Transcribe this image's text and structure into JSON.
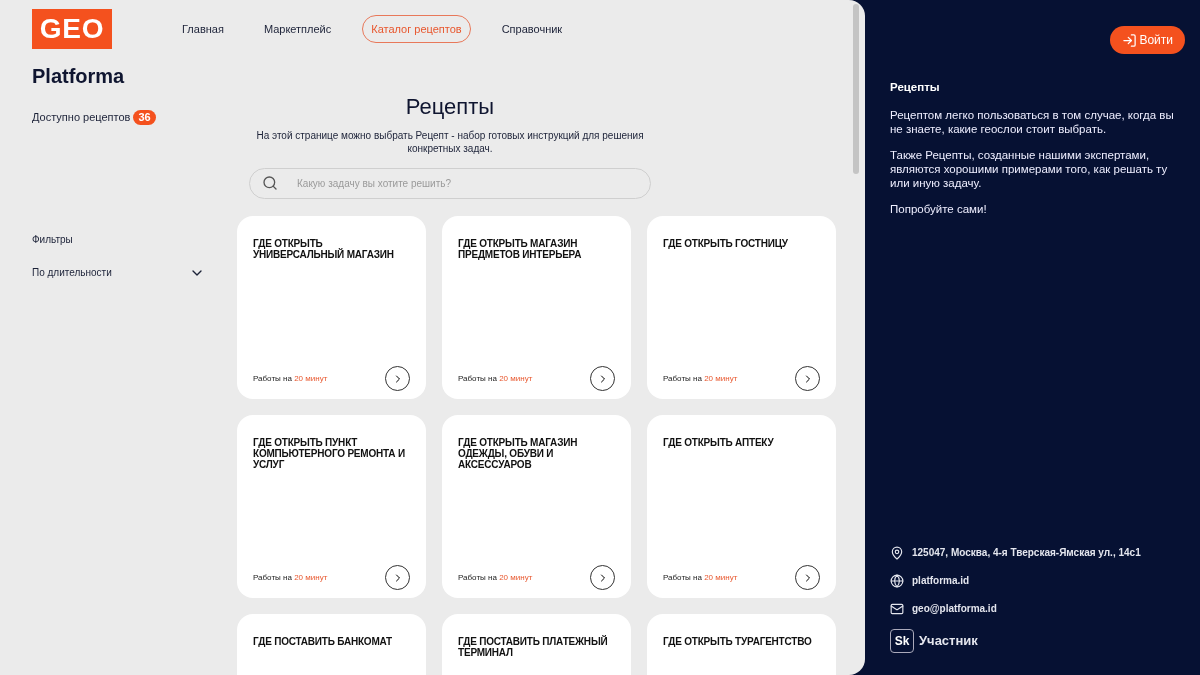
{
  "logo": "GEO",
  "nav": [
    {
      "label": "Главная",
      "selected": false
    },
    {
      "label": "Маркетплейс",
      "selected": false
    },
    {
      "label": "Каталог рецептов",
      "selected": true
    },
    {
      "label": "Справочник",
      "selected": false
    }
  ],
  "sidebar": {
    "brand": "Platforma",
    "available_label": "Доступно рецептов",
    "available_count": "36",
    "filters_title": "Фильтры",
    "filters": [
      {
        "label": "По длительности",
        "expanded": false
      }
    ]
  },
  "main": {
    "title": "Рецепты",
    "subtitle": "На этой странице можно выбрать Рецепт - набор готовых инструкций для решения конкретных задач.",
    "search": {
      "placeholder": "Какую задачу вы хотите решить?"
    },
    "cards": [
      {
        "title": "ГДЕ ОТКРЫТЬ УНИВЕРСАЛЬНЫЙ МАГАЗИН",
        "duration_label": "Работы на",
        "duration": "20 минут"
      },
      {
        "title": "ГДЕ ОТКРЫТЬ МАГАЗИН ПРЕДМЕТОВ ИНТЕРЬЕРА",
        "duration_label": "Работы на",
        "duration": "20 минут"
      },
      {
        "title": "ГДЕ ОТКРЫТЬ ГОСТНИЦУ",
        "duration_label": "Работы на",
        "duration": "20 минут"
      },
      {
        "title": "ГДЕ ОТКРЫТЬ ПУНКТ КОМПЬЮТЕРНОГО РЕМОНТА И УСЛУГ",
        "duration_label": "Работы на",
        "duration": "20 минут"
      },
      {
        "title": "ГДЕ ОТКРЫТЬ МАГАЗИН ОДЕЖДЫ, ОБУВИ И АКСЕССУАРОВ",
        "duration_label": "Работы на",
        "duration": "20 минут"
      },
      {
        "title": "ГДЕ ОТКРЫТЬ АПТЕКУ",
        "duration_label": "Работы на",
        "duration": "20 минут"
      },
      {
        "title": "ГДЕ ПОСТАВИТЬ БАНКОМАТ"
      },
      {
        "title": "ГДЕ ПОСТАВИТЬ ПЛАТЕЖНЫЙ ТЕРМИНАЛ"
      },
      {
        "title": "ГДЕ ОТКРЫТЬ ТУРАГЕНТСТВО"
      }
    ]
  },
  "info_panel": {
    "login_button": "Войти",
    "title": "Рецепты",
    "paragraphs": [
      "Рецептом легко пользоваться в том случае, когда вы не знаете, какие геослои стоит выбрать.",
      "Также Рецепты, созданные нашими экспертами, являются хорошими примерами того, как решать ту или иную задачу.",
      "Попробуйте сами!"
    ],
    "contacts": [
      {
        "kind": "address",
        "text": "125047, Москва, 4-я Тверская-Ямская ул., 14с1"
      },
      {
        "kind": "site",
        "text": "platforma.id"
      },
      {
        "kind": "email",
        "text": "geo@platforma.id"
      }
    ],
    "badge_logo": "Sk",
    "badge_text": "Участник"
  }
}
